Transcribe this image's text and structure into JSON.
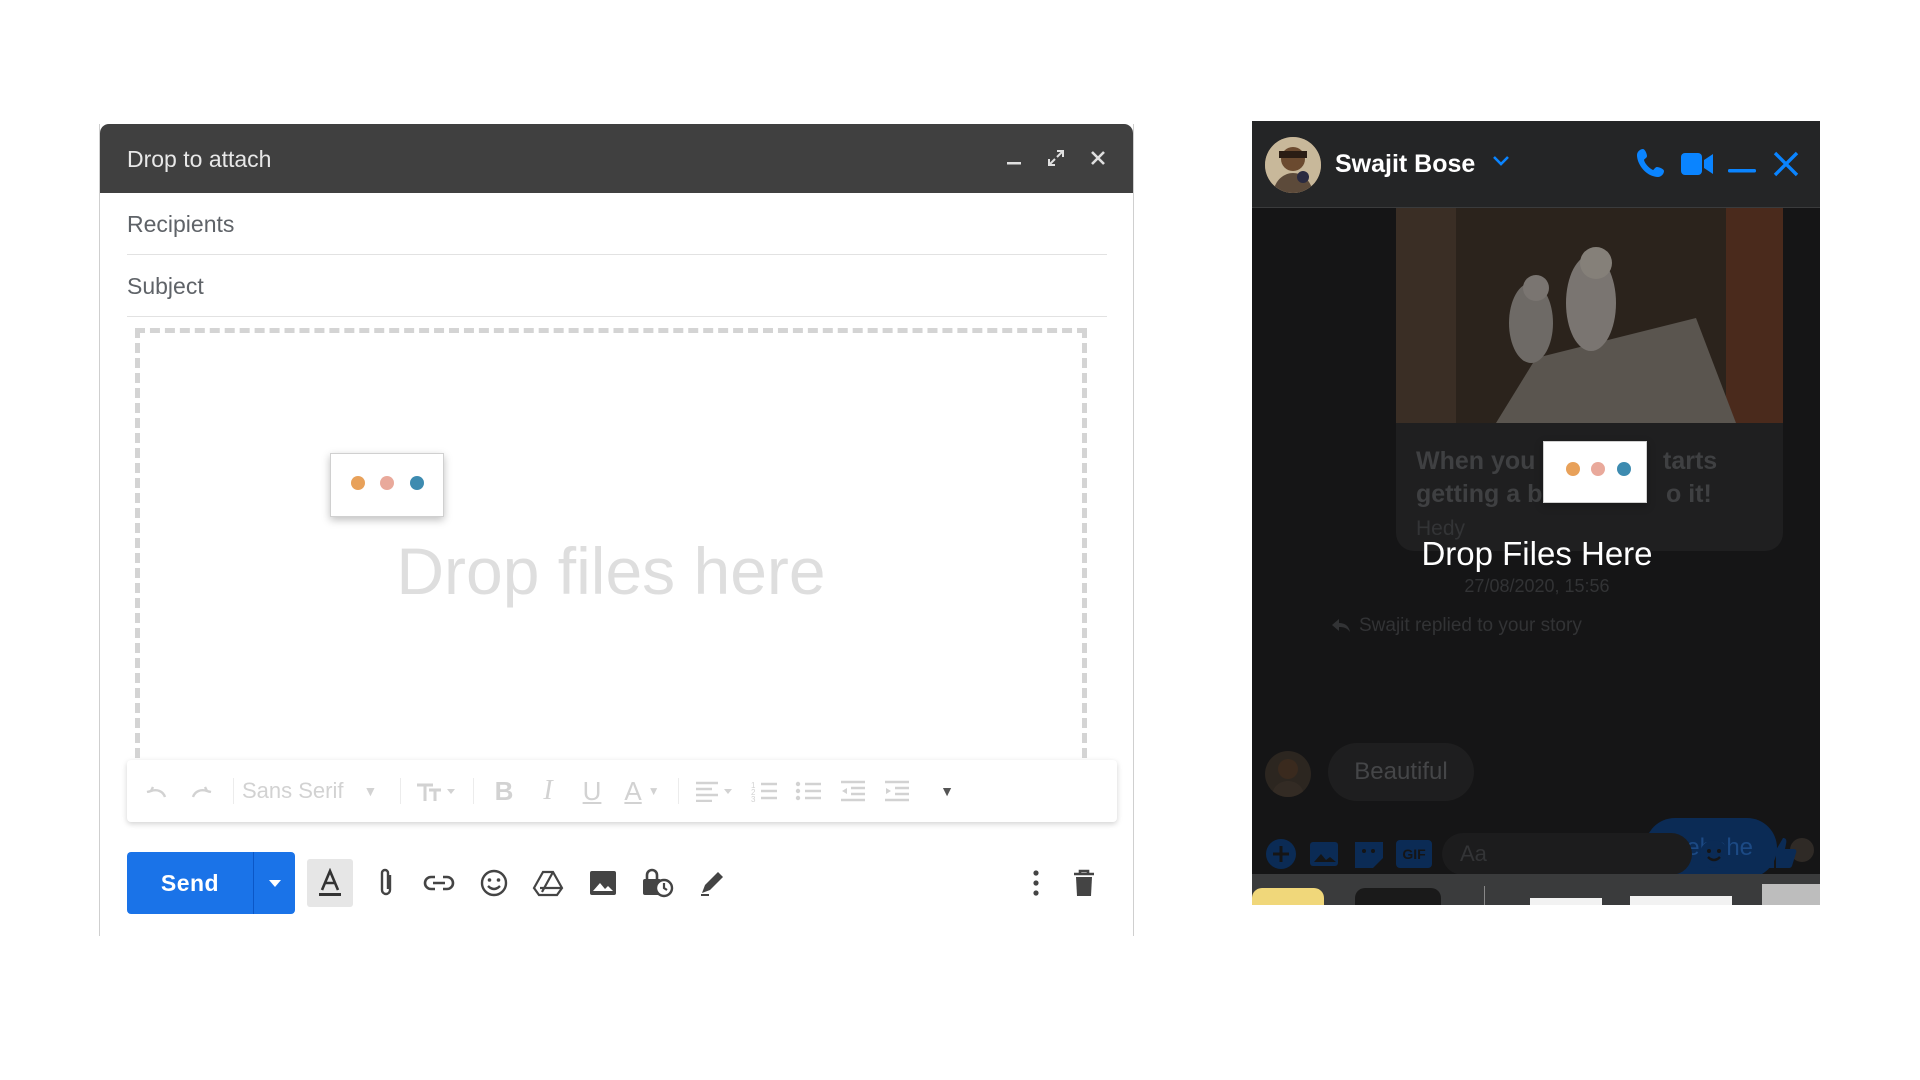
{
  "compose": {
    "title": "Drop to attach",
    "recipients_placeholder": "Recipients",
    "subject_placeholder": "Subject",
    "drop_text": "Drop files here",
    "font_label": "Sans Serif",
    "send_label": "Send",
    "icons": [
      "minimize-icon",
      "fullscreen-icon",
      "close-icon",
      "undo-icon",
      "redo-icon",
      "text-size-icon",
      "bold-icon",
      "italic-icon",
      "underline-icon",
      "text-color-icon",
      "align-icon",
      "numbered-list-icon",
      "bulleted-list-icon",
      "indent-less-icon",
      "indent-more-icon",
      "more-formatting-icon",
      "formatting-options-icon",
      "attach-icon",
      "link-icon",
      "emoji-icon",
      "drive-icon",
      "photo-icon",
      "confidential-icon",
      "signature-icon",
      "more-options-icon",
      "discard-icon"
    ],
    "accent": "#1a73e8"
  },
  "messenger": {
    "contact_name": "Swajit Bose",
    "story_caption_line1": "When you",
    "story_caption_line1b": "tarts",
    "story_caption_line2": "getting a b",
    "story_caption_line2b": "o it!",
    "story_author": "Hedy",
    "drop_label": "Drop Files Here",
    "timestamp": "27/08/2020, 15:56",
    "reply_note": "Swajit replied to your story",
    "message_received": "Beautiful",
    "message_sent": "Hehehe",
    "input_placeholder": "Aa",
    "accent": "#0a84ff"
  }
}
